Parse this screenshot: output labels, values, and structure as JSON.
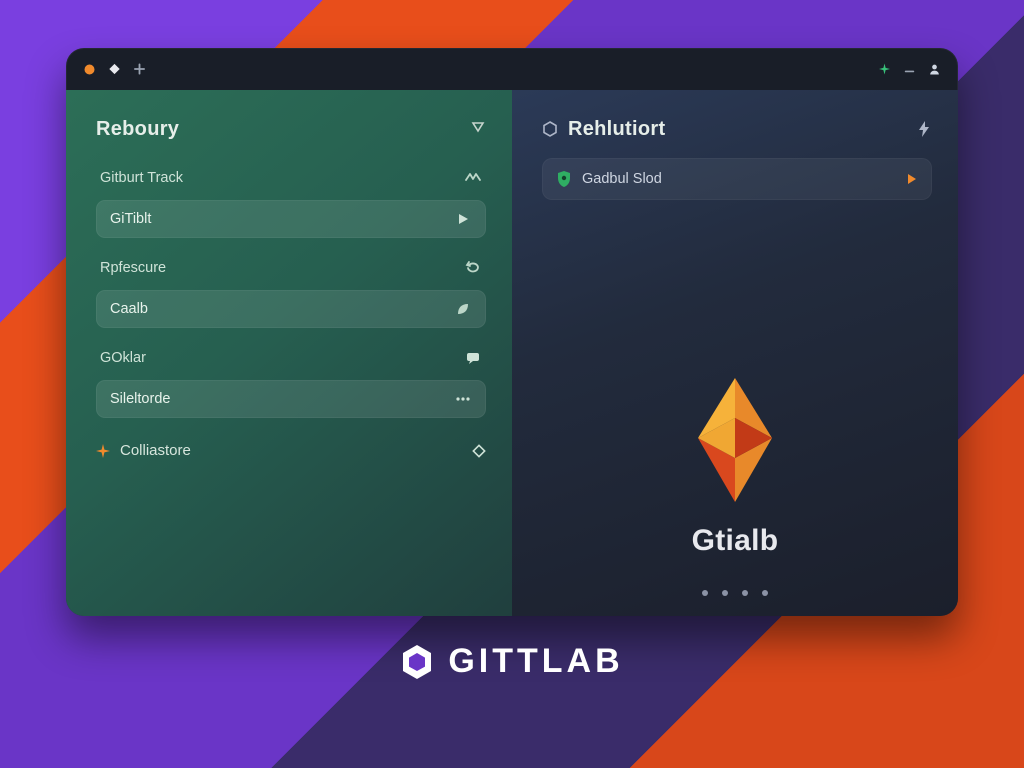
{
  "titlebar": {
    "left_icons": [
      "circle-dot-orange",
      "diamond-white",
      "plus"
    ],
    "right_icons": [
      "spark-green",
      "minimize",
      "user-silhouette"
    ]
  },
  "left_panel": {
    "header": {
      "title": "Reboury",
      "right_icon": "chevron-down-outline"
    },
    "rows": [
      {
        "type": "item",
        "label": "Gitburt Track",
        "icon": "wave"
      },
      {
        "type": "pill",
        "label": "GiTiblt",
        "icon": "play"
      },
      {
        "type": "item",
        "label": "Rpfescure",
        "icon": "loop"
      },
      {
        "type": "pill",
        "label": "Caalb",
        "icon": "leaf"
      },
      {
        "type": "item",
        "label": "GOklar",
        "icon": "chat"
      },
      {
        "type": "pill",
        "label": "Sileltorde",
        "icon": "dots"
      }
    ],
    "footer": {
      "label": "Colliastore",
      "left_icon": "spark-orange",
      "right_icon": "diamond-outline"
    }
  },
  "right_panel": {
    "header": {
      "left_icon": "hexagon-outline",
      "title": "Rehlutiort",
      "right_icon": "bolt"
    },
    "items": [
      {
        "label": "Gadbul Slod",
        "lead_icon": "shield-badge",
        "trail_icon": "chevron-marker-orange"
      }
    ],
    "logo_text": "Gtialb",
    "pager_count": 4
  },
  "brand_footer": {
    "text": "GITTLAB"
  },
  "colors": {
    "accent_orange": "#f08a2c",
    "accent_green": "#2fae63",
    "panel_left": "#2c6e57",
    "panel_right": "#222b3d"
  }
}
